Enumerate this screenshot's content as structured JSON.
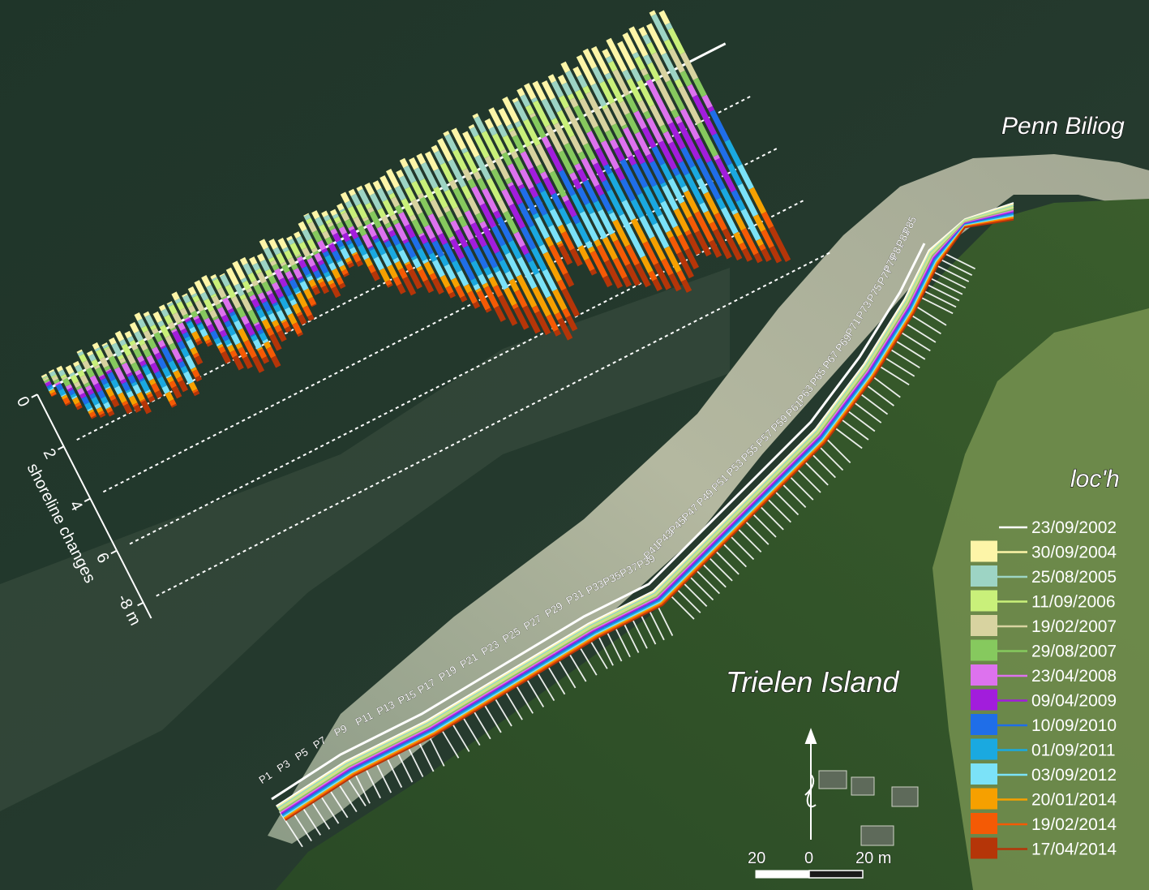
{
  "places": {
    "penn_biliog": "Penn Biliog",
    "loch": "loc'h",
    "trielen_island": "Trielen  Island"
  },
  "axis": {
    "title": "shoreline changes",
    "ticks": [
      "0",
      "2",
      "4",
      "6",
      "-8 m"
    ]
  },
  "scale_bar": {
    "left_label": "20",
    "center_label": "0",
    "right_label": "20 m"
  },
  "profile_labels": [
    "P1",
    "P3",
    "P5",
    "P7",
    "P9",
    "P11",
    "P13",
    "P15",
    "P17",
    "P19",
    "P21",
    "P23",
    "P25",
    "P27",
    "P29",
    "P31",
    "P33",
    "P35",
    "P37",
    "P39",
    "P41",
    "P43",
    "P45",
    "P47",
    "P49",
    "P51",
    "P53",
    "P55",
    "P57",
    "P59",
    "P61",
    "P63",
    "P65",
    "P67",
    "P69",
    "P71",
    "P73",
    "P75",
    "P77",
    "P79",
    "P81",
    "P83",
    "P85"
  ],
  "legend": [
    {
      "date": "23/09/2002",
      "color": "#ffffff",
      "swatch": false
    },
    {
      "date": "30/09/2004",
      "color": "#fdf5a8",
      "swatch": true
    },
    {
      "date": "25/08/2005",
      "color": "#9dd4c4",
      "swatch": true
    },
    {
      "date": "11/09/2006",
      "color": "#c9f07a",
      "swatch": true
    },
    {
      "date": "19/02/2007",
      "color": "#d8d3a0",
      "swatch": true
    },
    {
      "date": "29/08/2007",
      "color": "#86c95e",
      "swatch": true
    },
    {
      "date": "23/04/2008",
      "color": "#dd72ee",
      "swatch": true
    },
    {
      "date": "09/04/2009",
      "color": "#a21ddc",
      "swatch": true
    },
    {
      "date": "10/09/2010",
      "color": "#1f6ee8",
      "swatch": true
    },
    {
      "date": "01/09/2011",
      "color": "#1aa9e0",
      "swatch": true
    },
    {
      "date": "03/09/2012",
      "color": "#7be2f8",
      "swatch": true
    },
    {
      "date": "20/01/2014",
      "color": "#f6a000",
      "swatch": true
    },
    {
      "date": "19/02/2014",
      "color": "#f45a05",
      "swatch": true
    },
    {
      "date": "17/04/2014",
      "color": "#b53508",
      "swatch": true
    }
  ],
  "chart_data": {
    "type": "bar",
    "orientation": "stacked shoreline retreat per profile (rotated along coast)",
    "ylabel": "shoreline changes",
    "yunit": "m",
    "ylim": [
      0,
      -8
    ],
    "categories_count": 85,
    "totals_m": [
      -0.3,
      -0.8,
      -1.1,
      -1.6,
      -1.7,
      -1.8,
      -1.6,
      -2.0,
      -2.1,
      -2.3,
      -2.0,
      -2.0,
      -2.5,
      -2.3,
      -2.2,
      -2.5,
      -2.1,
      -1.6,
      -1.0,
      -1.2,
      -2.0,
      -2.4,
      -2.5,
      -2.8,
      -2.6,
      -2.9,
      -2.4,
      -2.2,
      -2.0,
      -2.3,
      -2.0,
      -2.0,
      -1.6,
      -1.3,
      -1.4,
      -1.7,
      -1.5,
      -1.2,
      -1.0,
      -1.1,
      -1.8,
      -2.2,
      -2.6,
      -2.8,
      -2.7,
      -3.0,
      -3.2,
      -3.5,
      -3.8,
      -4.2,
      -4.5,
      -5.0,
      -5.3,
      -5.6,
      -5.9,
      -6.1,
      -6.3,
      -6.6,
      -6.4,
      -6.0,
      -5.0,
      -4.3,
      -4.5,
      -5.0,
      -5.6,
      -5.8,
      -5.9,
      -6.0,
      -6.2,
      -6.5,
      -6.6,
      -6.8,
      -7.0,
      -6.6,
      -6.4,
      -6.0,
      -6.2,
      -6.4,
      -6.6,
      -6.8,
      -7.0,
      -7.2,
      -7.3,
      -7.5,
      -7.6
    ]
  }
}
